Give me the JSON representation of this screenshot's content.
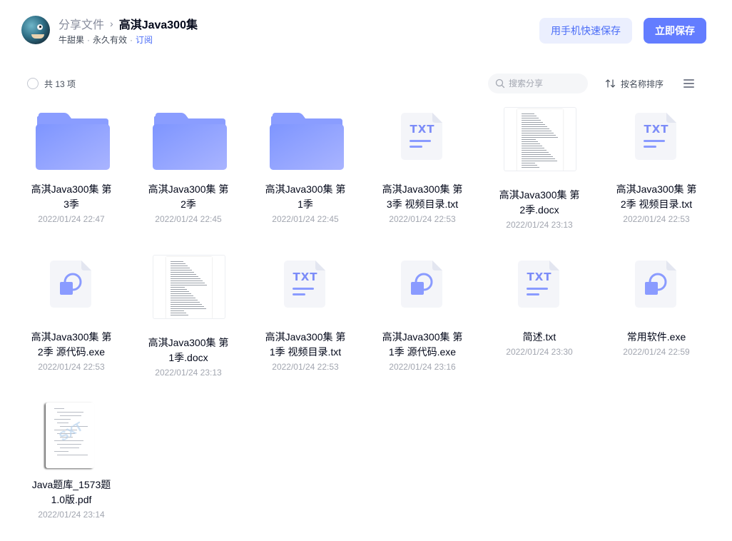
{
  "header": {
    "breadcrumb_root": "分享文件",
    "breadcrumb_sep": "›",
    "title": "高淇Java300集",
    "owner": "牛甜果",
    "validity": "永久有效",
    "subscribe": "订阅",
    "meta_dot": "·"
  },
  "buttons": {
    "phone_save": "用手机快速保存",
    "save_now": "立即保存"
  },
  "toolbar": {
    "count_label": "共 13 项",
    "search_placeholder": "搜索分享",
    "sort_label": "按名称排序"
  },
  "colors": {
    "accent": "#637dff",
    "folder": "#8a9bff",
    "text_muted": "#a2a6b0"
  },
  "files": [
    {
      "type": "folder",
      "name_l1": "高淇Java300集 第",
      "name_l2": "3季",
      "time": "2022/01/24 22:47"
    },
    {
      "type": "folder",
      "name_l1": "高淇Java300集 第",
      "name_l2": "2季",
      "time": "2022/01/24 22:45"
    },
    {
      "type": "folder",
      "name_l1": "高淇Java300集 第",
      "name_l2": "1季",
      "time": "2022/01/24 22:45"
    },
    {
      "type": "txt",
      "name_l1": "高淇Java300集 第",
      "name_l2": "3季 视频目录.txt",
      "time": "2022/01/24 22:53",
      "icon_text": "TXT"
    },
    {
      "type": "docx",
      "name_l1": "高淇Java300集 第",
      "name_l2": "2季.docx",
      "time": "2022/01/24 23:13"
    },
    {
      "type": "txt",
      "name_l1": "高淇Java300集 第",
      "name_l2": "2季 视频目录.txt",
      "time": "2022/01/24 22:53",
      "icon_text": "TXT"
    },
    {
      "type": "exe",
      "name_l1": "高淇Java300集 第",
      "name_l2": "2季 源代码.exe",
      "time": "2022/01/24 22:53"
    },
    {
      "type": "docx",
      "name_l1": "高淇Java300集 第",
      "name_l2": "1季.docx",
      "time": "2022/01/24 23:13"
    },
    {
      "type": "txt",
      "name_l1": "高淇Java300集 第",
      "name_l2": "1季 视频目录.txt",
      "time": "2022/01/24 22:53",
      "icon_text": "TXT"
    },
    {
      "type": "exe",
      "name_l1": "高淇Java300集 第",
      "name_l2": "1季 源代码.exe",
      "time": "2022/01/24 23:16"
    },
    {
      "type": "txt",
      "name_l1": "简述.txt",
      "name_l2": "",
      "time": "2022/01/24 23:30",
      "icon_text": "TXT"
    },
    {
      "type": "exe",
      "name_l1": "常用软件.exe",
      "name_l2": "",
      "time": "2022/01/24 22:59"
    },
    {
      "type": "pdf",
      "name_l1": "Java题库_1573题",
      "name_l2": "1.0版.pdf",
      "time": "2022/01/24 23:14"
    }
  ]
}
